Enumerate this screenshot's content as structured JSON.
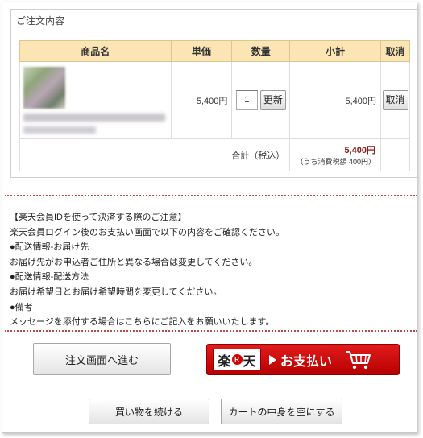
{
  "order": {
    "title": "ご注文内容",
    "headers": {
      "name": "商品名",
      "price": "単価",
      "qty": "数量",
      "subtotal": "小計",
      "remove": "取消"
    },
    "item": {
      "unit_price": "5,400円",
      "quantity": "1",
      "update_label": "更新",
      "subtotal": "5,400円",
      "remove_label": "取消"
    },
    "total": {
      "label": "合計（税込）",
      "value": "5,400円",
      "tax_note": "（うち消費税額 400円）"
    }
  },
  "notice": {
    "lines": [
      "【楽天会員IDを使って決済する際のご注意】",
      "楽天会員ログイン後のお支払い画面で以下の内容をご確認ください。",
      "●配送情報-お届け先",
      "お届け先がお申込者ご住所と異なる場合は変更してください。",
      "●配送情報-配送方法",
      "お届け希望日とお届け希望時間を変更してください。",
      "●備考",
      "メッセージを添付する場合はこちらにご記入をお願いいたします。"
    ]
  },
  "actions": {
    "proceed_label": "注文画面へ進む",
    "pay_logo": {
      "left": "楽",
      "mark": "R",
      "right": "天"
    },
    "pay_label": "お支払い",
    "continue_label": "買い物を続ける",
    "empty_label": "カートの中身を空にする"
  },
  "colors": {
    "header_bg": "#fbe5b5",
    "total_value": "#8b1a1a",
    "pay_button": "#d40000",
    "divider": "#c24a4a"
  }
}
